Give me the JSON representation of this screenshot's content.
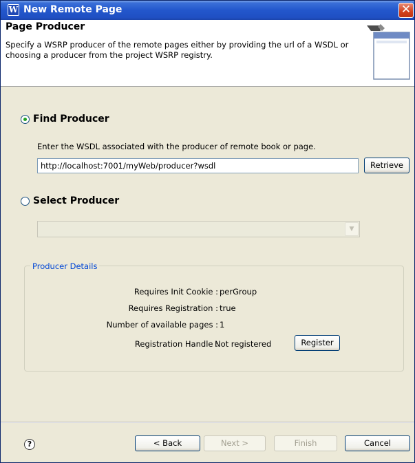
{
  "window": {
    "title": "New Remote Page",
    "icon_glyph": "W",
    "close_glyph": "✕"
  },
  "header": {
    "title": "Page Producer",
    "description": "Specify a WSRP producer of the remote pages either by providing the url of a WSDL or choosing a producer from the project WSRP registry."
  },
  "find_producer": {
    "label": "Find Producer",
    "selected": true,
    "instruction": "Enter the WSDL associated with the producer of remote book or page.",
    "wsdl_value": "http://localhost:7001/myWeb/producer?wsdl",
    "retrieve_label": "Retrieve"
  },
  "select_producer": {
    "label": "Select Producer",
    "selected": false,
    "selected_value": "",
    "enabled": false
  },
  "producer_details": {
    "legend": "Producer Details",
    "rows": [
      {
        "label": "Requires Init Cookie :",
        "value": "perGroup"
      },
      {
        "label": "Requires Registration :",
        "value": "true"
      },
      {
        "label": "Number of available pages :",
        "value": "1"
      },
      {
        "label": "Registration Handle :",
        "value": "Not registered"
      }
    ],
    "register_label": "Register"
  },
  "footer": {
    "help_glyph": "?",
    "back_label": "< Back",
    "next_label": "Next >",
    "finish_label": "Finish",
    "cancel_label": "Cancel",
    "next_enabled": false,
    "finish_enabled": false
  },
  "colors": {
    "title_bar": "#2357cc",
    "dialog_bg": "#ece9d8",
    "group_legend": "#0046d5",
    "radio_dot": "#21a121"
  }
}
